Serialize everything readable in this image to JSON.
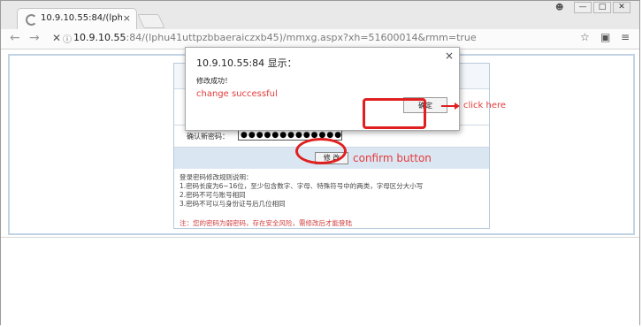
{
  "browser": {
    "tab_title": "10.9.10.55:84/(lphu41u",
    "tab_close": "×",
    "url_host": "10.9.10.55",
    "url_path": ":84/(lphu41uttpzbbaeraiczxb45)/mmxg.aspx?xh=51600014&rmm=true",
    "window_minimize": "—",
    "window_maximize": "□",
    "window_close": "✕",
    "back": "←",
    "forward": "→",
    "stop": "✕",
    "bookmark_icon": "☆",
    "extension_icon": "▣",
    "menu_icon": "≡",
    "account_icon": "☻"
  },
  "form": {
    "row1_label": "输",
    "row2_label": "输",
    "confirm_label": "确认新密码：",
    "confirm_value": "●●●●●●●●●●●●●",
    "modify_button": "修  改",
    "rules_title": "登录密码修改规则说明：",
    "rule1": "1.密码长度为6~16位，至少包含数字、字母、特殊符号中的两类，字母区分大小写",
    "rule2": "2.密码不可与账号相同",
    "rule3": "3.密码不可以与身份证号后几位相同",
    "note": "注：您的密码为弱密码，存在安全风险，需修改后才能登陆"
  },
  "dialog": {
    "title": "10.9.10.55:84 显示：",
    "close": "×",
    "message": "修改成功！",
    "ok_button": "确定"
  },
  "annotations": {
    "change_successful": "change successful",
    "click_here": "click here",
    "confirm_button": "confirm button",
    "color": "#e23a3a"
  }
}
